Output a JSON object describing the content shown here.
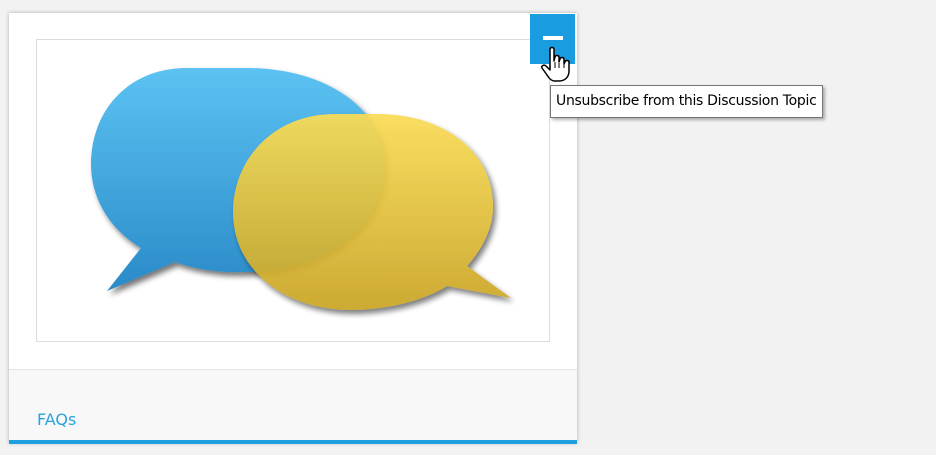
{
  "card": {
    "title": "FAQs",
    "image_icon": "speech-bubbles-icon",
    "action_icon": "minus-icon",
    "tooltip": "Unsubscribe from this Discussion Topic"
  },
  "cursor": {
    "icon": "hand-pointer-icon"
  },
  "colors": {
    "accent": "#1a9ce0",
    "title_link": "#2aa3dd",
    "bubble_blue": "#4fb2e6",
    "bubble_yellow": "#e8c43a",
    "page_background": "#f2f2f2"
  }
}
